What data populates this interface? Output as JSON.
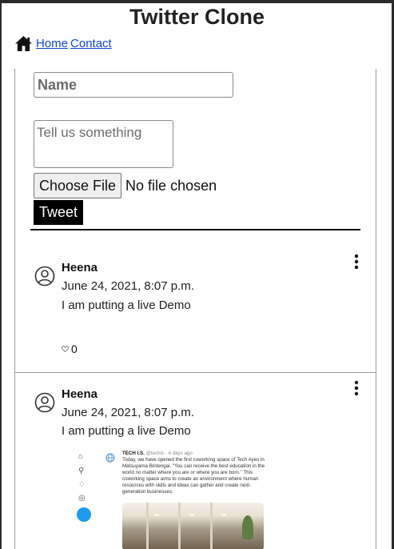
{
  "header": {
    "title": "Twitter Clone",
    "nav": [
      {
        "label": "Home"
      },
      {
        "label": "Contact"
      }
    ]
  },
  "form": {
    "name_placeholder": "Name",
    "message_placeholder": "Tell us something",
    "file_button": "Choose File",
    "file_status": "No file chosen",
    "submit_label": "Tweet"
  },
  "tweets": [
    {
      "author": "Heena",
      "date": "June 24, 2021, 8:07 p.m.",
      "text": "I am putting a live Demo",
      "likes": "0"
    },
    {
      "author": "Heena",
      "date": "June 24, 2021, 8:07 p.m.",
      "text": "I am putting a live Demo",
      "image": {
        "account": "TECH I.S.",
        "handle": "@techis · 4 days ago",
        "body": "Today, we have opened the first coworking space of Tech Ayes in Matsuyama Bintengai. \"You can receive the best education in the world no matter where you are or where you are born.\" This coworking space aims to create an environment where human resources with skills and ideas can gather and create next-generation businesses."
      }
    }
  ],
  "colors": {
    "link": "#0d47d9",
    "tweet_button_bg": "#000000",
    "compose_blue": "#1d9bf0"
  }
}
